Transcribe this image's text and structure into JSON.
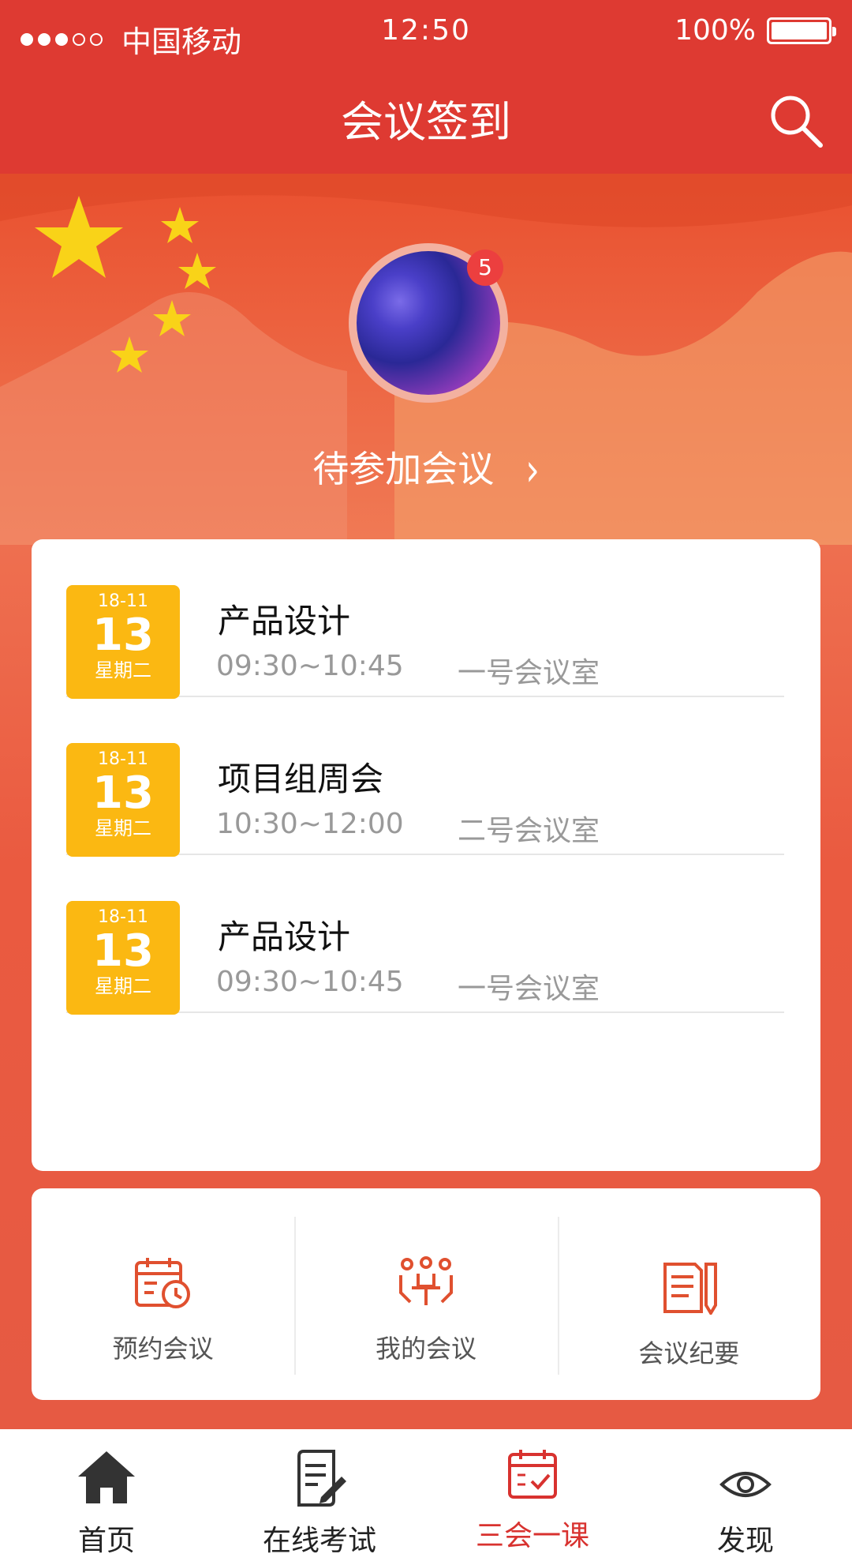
{
  "status_bar": {
    "carrier": "中国移动",
    "time": "12:50",
    "battery": "100%"
  },
  "nav": {
    "title": "会议签到"
  },
  "hero": {
    "badge": "5",
    "pending_label": "待参加会议"
  },
  "meetings": [
    {
      "ym": "18-11",
      "day": "13",
      "weekday": "星期二",
      "name": "产品设计",
      "time": "09:30~10:45",
      "room": "一号会议室"
    },
    {
      "ym": "18-11",
      "day": "13",
      "weekday": "星期二",
      "name": "项目组周会",
      "time": "10:30~12:00",
      "room": "二号会议室"
    },
    {
      "ym": "18-11",
      "day": "13",
      "weekday": "星期二",
      "name": "产品设计",
      "time": "09:30~10:45",
      "room": "一号会议室"
    }
  ],
  "actions": [
    {
      "label": "预约会议",
      "icon": "calendar-clock-icon"
    },
    {
      "label": "我的会议",
      "icon": "people-meeting-icon"
    },
    {
      "label": "会议纪要",
      "icon": "notes-pencil-icon"
    }
  ],
  "tabs": [
    {
      "label": "首页",
      "icon": "home-icon"
    },
    {
      "label": "在线考试",
      "icon": "exam-icon"
    },
    {
      "label": "三会一课",
      "icon": "calendar-check-icon",
      "active": true
    },
    {
      "label": "发现",
      "icon": "eye-icon"
    }
  ],
  "colors": {
    "primary": "#de3a32",
    "date_badge": "#fbb812",
    "icon_red": "#e0502f"
  }
}
